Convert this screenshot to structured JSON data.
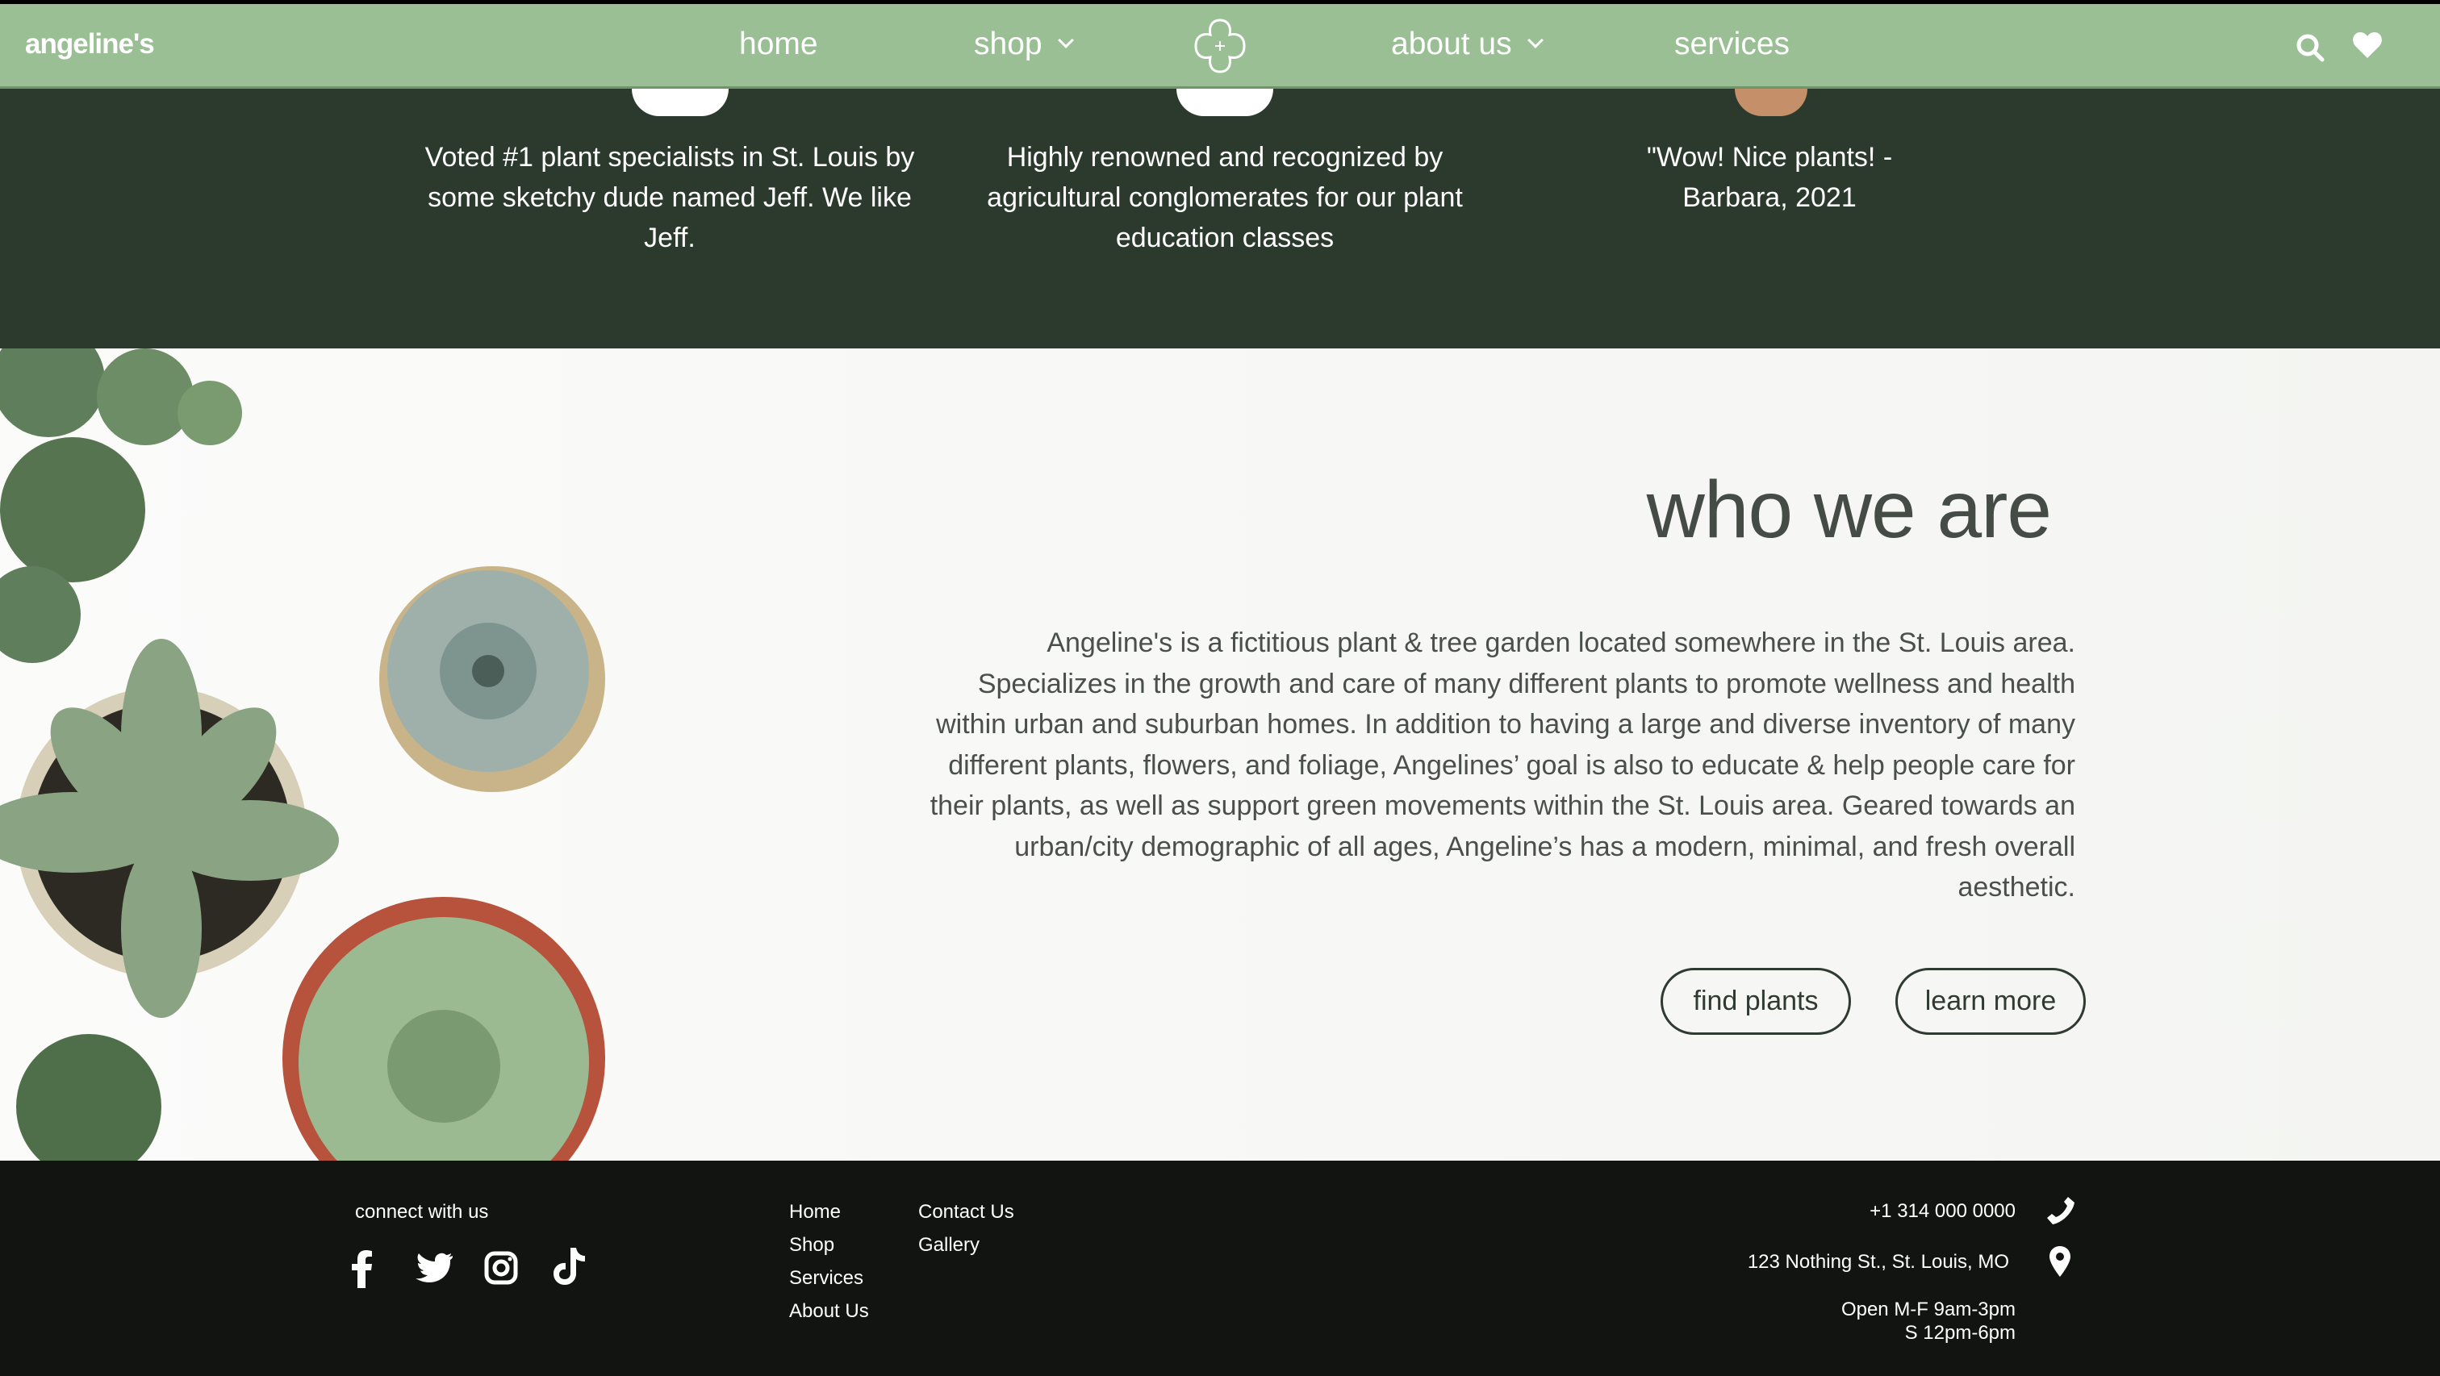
{
  "nav": {
    "logo": "angeline's",
    "items": [
      {
        "label": "home"
      },
      {
        "label": "shop"
      },
      {
        "label": "about us"
      },
      {
        "label": "services"
      }
    ]
  },
  "quotes": [
    "Voted #1 plant specialists in St. Louis by some sketchy dude named Jeff. We like Jeff.",
    "Highly renowned and recognized by agricultural conglomerates for our plant education classes",
    "\"Wow! Nice plants! -Barbara, 2021"
  ],
  "about": {
    "heading": "who we are",
    "paragraph": "Angeline's is a fictitious plant & tree garden located somewhere in the St. Louis area. Specializes in the growth and care of many different plants to promote wellness and health within urban and suburban homes. In addition to having a large and diverse inventory of many different plants, flowers, and foliage, Angelines’ goal is also to educate & help people care for their plants, as well as support green movements within the St. Louis area. Geared towards an urban/city demographic of all ages, Angeline’s has a modern, minimal, and fresh overall aesthetic.",
    "buttons": [
      "find plants",
      "learn more"
    ]
  },
  "footer": {
    "connect": "connect with us",
    "links_col1": [
      "Home",
      "Shop",
      "Services",
      "About Us"
    ],
    "links_col2": [
      "Contact Us",
      "Gallery"
    ],
    "phone": "+1 314 000 0000",
    "address": "123 Nothing St., St. Louis, MO",
    "hours1": "Open M-F 9am-3pm",
    "hours2": "S 12pm-6pm"
  },
  "colors": {
    "nav": "#9abf94",
    "dark": "#2c3a2d",
    "footer": "#121412"
  }
}
